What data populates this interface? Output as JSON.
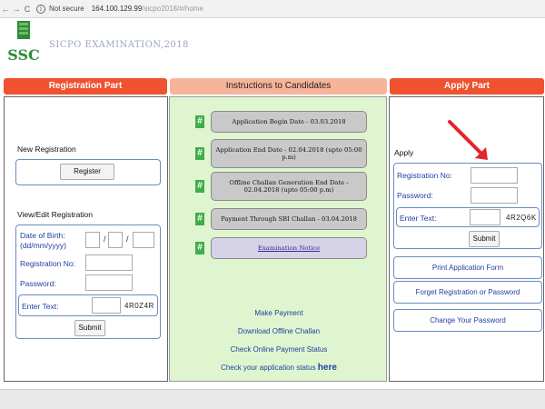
{
  "browser": {
    "back": "←",
    "forward": "→",
    "reload": "C",
    "info": "i",
    "security": "Not secure",
    "url_host": "164.100.129.99",
    "url_path": "/sicpo2018/#/home"
  },
  "header": {
    "logo_text": "SSC",
    "site_title": "SICPO EXAMINATION,2018"
  },
  "registration": {
    "title": "Registration Part",
    "new_heading": "New Registration",
    "register_label": "Register",
    "view_heading": "View/Edit Registration",
    "dob_label": "Date of Birth:",
    "dob_format": "(dd/mm/yyyy)",
    "dob_sep": "/",
    "reg_no_label": "Registration No:",
    "password_label": "Password:",
    "enter_text_label": "Enter Text:",
    "captcha": "4R0Z4R",
    "submit_label": "Submit"
  },
  "instructions": {
    "title": "Instructions to Candidates",
    "hash": "#",
    "steps": [
      "Application Begin Date - 03.03.2018",
      "Application End Date - 02.04.2018 (upto 05:00 p.m)",
      "Offline Challan Generation End Date - 02.04.2018 (upto 05:00 p.m)",
      "Payment Through SBI Challan - 03.04.2018",
      "Examination Notice"
    ],
    "links": {
      "make_payment": "Make Payment",
      "download_challan": "Download Offline Challan",
      "check_status": "Check Online Payment Status",
      "check_app_status": "Check your application status",
      "here": "here"
    }
  },
  "apply": {
    "title": "Apply Part",
    "heading": "Apply",
    "reg_no_label": "Registration No:",
    "password_label": "Password:",
    "enter_text_label": "Enter Text:",
    "captcha": "4R2Q6K",
    "submit_label": "Submit",
    "print_form": "Print Application Form",
    "forget": "Forget Registration or Password",
    "change_password": "Change Your Password"
  },
  "colors": {
    "header_red": "#f0522f",
    "header_peach": "#f7b49a",
    "mid_green": "#dff5cf",
    "link_blue": "#1f3fa0",
    "hash_green": "#3fae49",
    "arrow_red": "#e3262b"
  }
}
